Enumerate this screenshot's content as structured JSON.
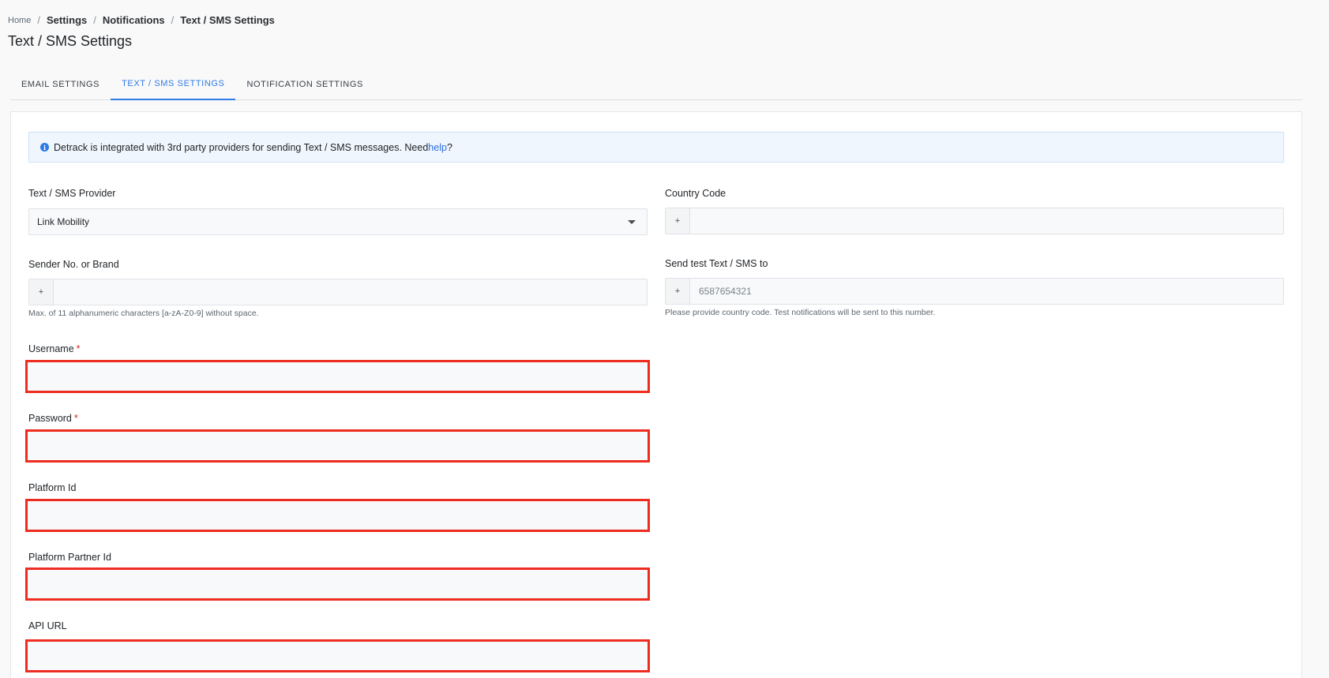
{
  "breadcrumb": {
    "home": "Home",
    "settings": "Settings",
    "notifications": "Notifications",
    "current": "Text / SMS Settings",
    "separator": "/"
  },
  "page": {
    "title": "Text / SMS Settings"
  },
  "tabs": [
    {
      "label": "EMAIL SETTINGS",
      "active": false
    },
    {
      "label": "TEXT / SMS SETTINGS",
      "active": true
    },
    {
      "label": "NOTIFICATION SETTINGS",
      "active": false
    }
  ],
  "alert": {
    "icon": "info-icon",
    "text": "Detrack is integrated with 3rd party providers for sending Text / SMS messages. Need ",
    "link": "help",
    "suffix": "?"
  },
  "form": {
    "provider": {
      "label": "Text / SMS Provider",
      "value": "Link Mobility"
    },
    "country_code": {
      "label": "Country Code",
      "prefix": "+",
      "value": ""
    },
    "sender": {
      "label": "Sender No. or Brand",
      "prefix": "+",
      "value": "",
      "help": "Max. of 11 alphanumeric characters [a-zA-Z0-9] without space."
    },
    "test_to": {
      "label": "Send test Text / SMS to",
      "prefix": "+",
      "placeholder": "6587654321",
      "help": "Please provide country code. Test notifications will be sent to this number."
    },
    "username": {
      "label": "Username",
      "required_mark": "*",
      "value": ""
    },
    "password": {
      "label": "Password",
      "required_mark": "*",
      "value": ""
    },
    "platform_id": {
      "label": "Platform Id",
      "value": ""
    },
    "platform_partner_id": {
      "label": "Platform Partner Id",
      "value": ""
    },
    "api_url": {
      "label": "API URL",
      "value": ""
    }
  },
  "colors": {
    "accent": "#2f7be8",
    "highlight": "#ee2c1f",
    "required": "#e02424"
  }
}
